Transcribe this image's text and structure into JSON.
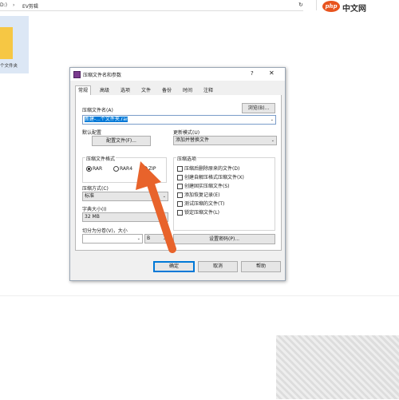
{
  "explorer": {
    "address_part1": "D:)",
    "address_sep": "›",
    "address_part2": "EV剪辑",
    "address_refresh": "↻",
    "folder_label": "个文件夹"
  },
  "logo": {
    "php": "php",
    "cn": "中文网"
  },
  "dialog": {
    "title": "压缩文件名和参数",
    "help": "?",
    "close": "✕",
    "tabs": [
      "常规",
      "高级",
      "选项",
      "文件",
      "备份",
      "时间",
      "注释"
    ],
    "archive_name_label": "压缩文件名(A)",
    "browse_button": "浏览(B)...",
    "archive_name_value": "新建-...个文件夹.rar",
    "default_profile_label": "默认配置",
    "profiles_button": "配置文件(F)...",
    "update_mode_label": "更新模式(U)",
    "update_mode_value": "添加并替换文件",
    "format_group_title": "压缩文件格式",
    "format_options": [
      "RAR",
      "RAR4",
      "ZIP"
    ],
    "format_selected": "RAR",
    "method_label": "压缩方式(C)",
    "method_value": "标准",
    "dict_label": "字典大小(I)",
    "dict_value": "32 MB",
    "split_label": "切分为分卷(V)，大小",
    "split_unit": "B",
    "options_group_title": "压缩选项",
    "options": [
      "压缩后删除原来的文件(D)",
      "创建自解压格式压缩文件(X)",
      "创建固实压缩文件(S)",
      "添加恢复记录(E)",
      "测试压缩的文件(T)",
      "锁定压缩文件(L)"
    ],
    "password_button": "设置密码(P)...",
    "ok_button": "确定",
    "cancel_button": "取消",
    "help_button": "帮助"
  },
  "colors": {
    "arrow": "#e8632b",
    "accent": "#0078d7"
  }
}
